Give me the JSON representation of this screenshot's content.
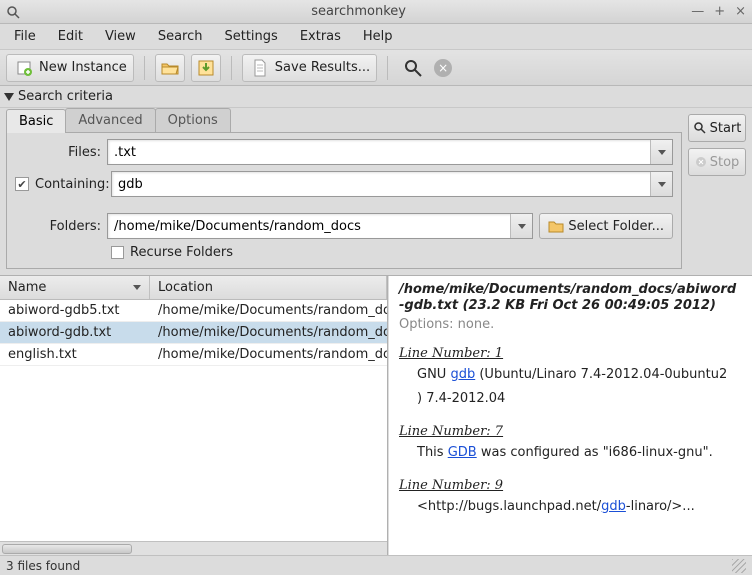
{
  "window": {
    "title": "searchmonkey"
  },
  "menu": {
    "items": [
      "File",
      "Edit",
      "View",
      "Search",
      "Settings",
      "Extras",
      "Help"
    ]
  },
  "toolbar": {
    "new_instance": "New Instance",
    "save_results": "Save Results..."
  },
  "section": {
    "title": "Search criteria"
  },
  "tabs": {
    "basic": "Basic",
    "advanced": "Advanced",
    "options": "Options"
  },
  "form": {
    "files_label": "Files:",
    "files_value": ".txt",
    "containing_checked": true,
    "containing_label": "Containing:",
    "containing_value": "gdb",
    "folders_label": "Folders:",
    "folders_value": "/home/mike/Documents/random_docs",
    "select_folder_label": "Select Folder...",
    "recurse_label": "Recurse Folders"
  },
  "buttons": {
    "start": "Start",
    "stop": "Stop"
  },
  "columns": {
    "name": "Name",
    "location": "Location"
  },
  "rows": [
    {
      "name": "abiword-gdb5.txt",
      "location": "/home/mike/Documents/random_do",
      "selected": false
    },
    {
      "name": "abiword-gdb.txt",
      "location": "/home/mike/Documents/random_do",
      "selected": true
    },
    {
      "name": "english.txt",
      "location": "/home/mike/Documents/random_do",
      "selected": false
    }
  ],
  "preview": {
    "path_line1": "/home/mike/Documents/random_docs/abiword",
    "path_line2": "-gdb.txt (23.2 KB Fri Oct 26 00:49:05 2012)",
    "options": "Options: none.",
    "line1_label": "Line Number: 1",
    "line1_a": "GNU ",
    "line1_hl": "gdb",
    "line1_b": " (Ubuntu/Linaro 7.4-2012.04-0ubuntu2",
    "line1_c": ") 7.4-2012.04",
    "line7_label": "Line Number: 7",
    "line7_a": "This ",
    "line7_hl": "GDB",
    "line7_b": " was configured as \"i686-linux-gnu\".",
    "line9_label": "Line Number: 9",
    "line9_a": "<http://bugs.launchpad.net/",
    "line9_hl": "gdb",
    "line9_b": "-linaro/>..."
  },
  "status": {
    "text": "3 files found"
  }
}
